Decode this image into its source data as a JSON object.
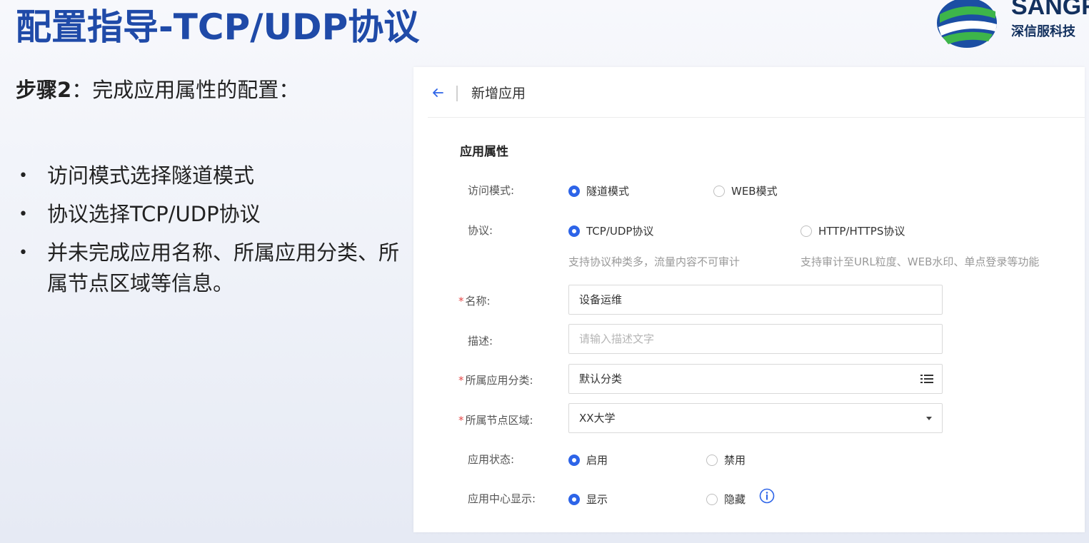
{
  "slide": {
    "title": "配置指导-TCP/UDP协议",
    "logo_en": "SANGF",
    "logo_cn": "深信服科技",
    "step_label": "步骤2",
    "step_text": "：完成应用属性的配置：",
    "bullets": [
      "访问模式选择隧道模式",
      "协议选择TCP/UDP协议",
      "并未完成应用名称、所属应用分类、所属节点区域等信息。"
    ]
  },
  "header": {
    "title": "新增应用"
  },
  "form": {
    "section_title": "应用属性",
    "access_mode": {
      "label": "访问模式:",
      "options": [
        "隧道模式",
        "WEB模式"
      ],
      "selected": "隧道模式"
    },
    "protocol": {
      "label": "协议:",
      "options": [
        "TCP/UDP协议",
        "HTTP/HTTPS协议"
      ],
      "selected": "TCP/UDP协议",
      "hints": [
        "支持协议种类多，流量内容不可审计",
        "支持审计至URL粒度、WEB水印、单点登录等功能"
      ]
    },
    "name": {
      "label": "名称:",
      "required_mark": "*",
      "value": "设备运维"
    },
    "description": {
      "label": "描述:",
      "placeholder": "请输入描述文字"
    },
    "category": {
      "label": "所属应用分类:",
      "required_mark": "*",
      "value": "默认分类",
      "icon": "list-icon"
    },
    "region": {
      "label": "所属节点区域:",
      "required_mark": "*",
      "value": "XX大学",
      "icon": "caret-down-icon"
    },
    "status": {
      "label": "应用状态:",
      "options": [
        "启用",
        "禁用"
      ],
      "selected": "启用"
    },
    "center_display": {
      "label": "应用中心显示:",
      "options": [
        "显示",
        "隐藏"
      ],
      "selected": "显示",
      "icon": "info-icon"
    }
  },
  "colors": {
    "accent": "#2d64e8",
    "title": "#1f4aa8",
    "required": "#e54848"
  }
}
